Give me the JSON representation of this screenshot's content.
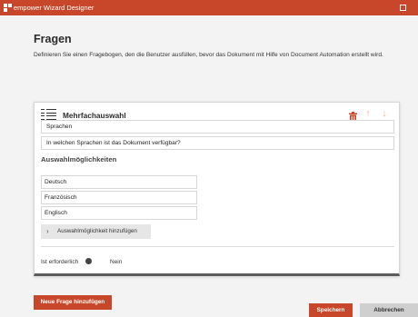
{
  "window": {
    "title": "empower Wizard Designer"
  },
  "page": {
    "title": "Fragen",
    "description": "Definieren Sie einen Fragebogen, den die Benutzer ausfüllen, bevor das Dokument mit Hilfe von Document Automation erstellt wird."
  },
  "question": {
    "type_label": "Mehrfachauswahl",
    "name": "Sprachen",
    "text": "In welchen Sprachen ist das Dokument verfügbar?",
    "options_title": "Auswahlmöglichkeiten",
    "options": [
      "Deutsch",
      "Französisch",
      "Englisch"
    ],
    "add_option_label": "Auswahlmöglichkeit hinzufügen",
    "required_label": "Ist erforderlich",
    "required_value": "Nein",
    "required_on": false
  },
  "actions": {
    "new_question": "Neue Frage hinzufügen",
    "save": "Speichern",
    "cancel": "Abbrechen"
  },
  "icons": {
    "app": "app-logo-icon",
    "maximize": "maximize-icon",
    "list": "list-icon",
    "delete": "trash-icon",
    "up": "arrow-up-icon",
    "down": "arrow-down-icon",
    "chevron": "chevron-right-icon"
  },
  "colors": {
    "accent": "#c8472a",
    "accent_muted": "#f0b49e",
    "background": "#f3f3f3"
  }
}
